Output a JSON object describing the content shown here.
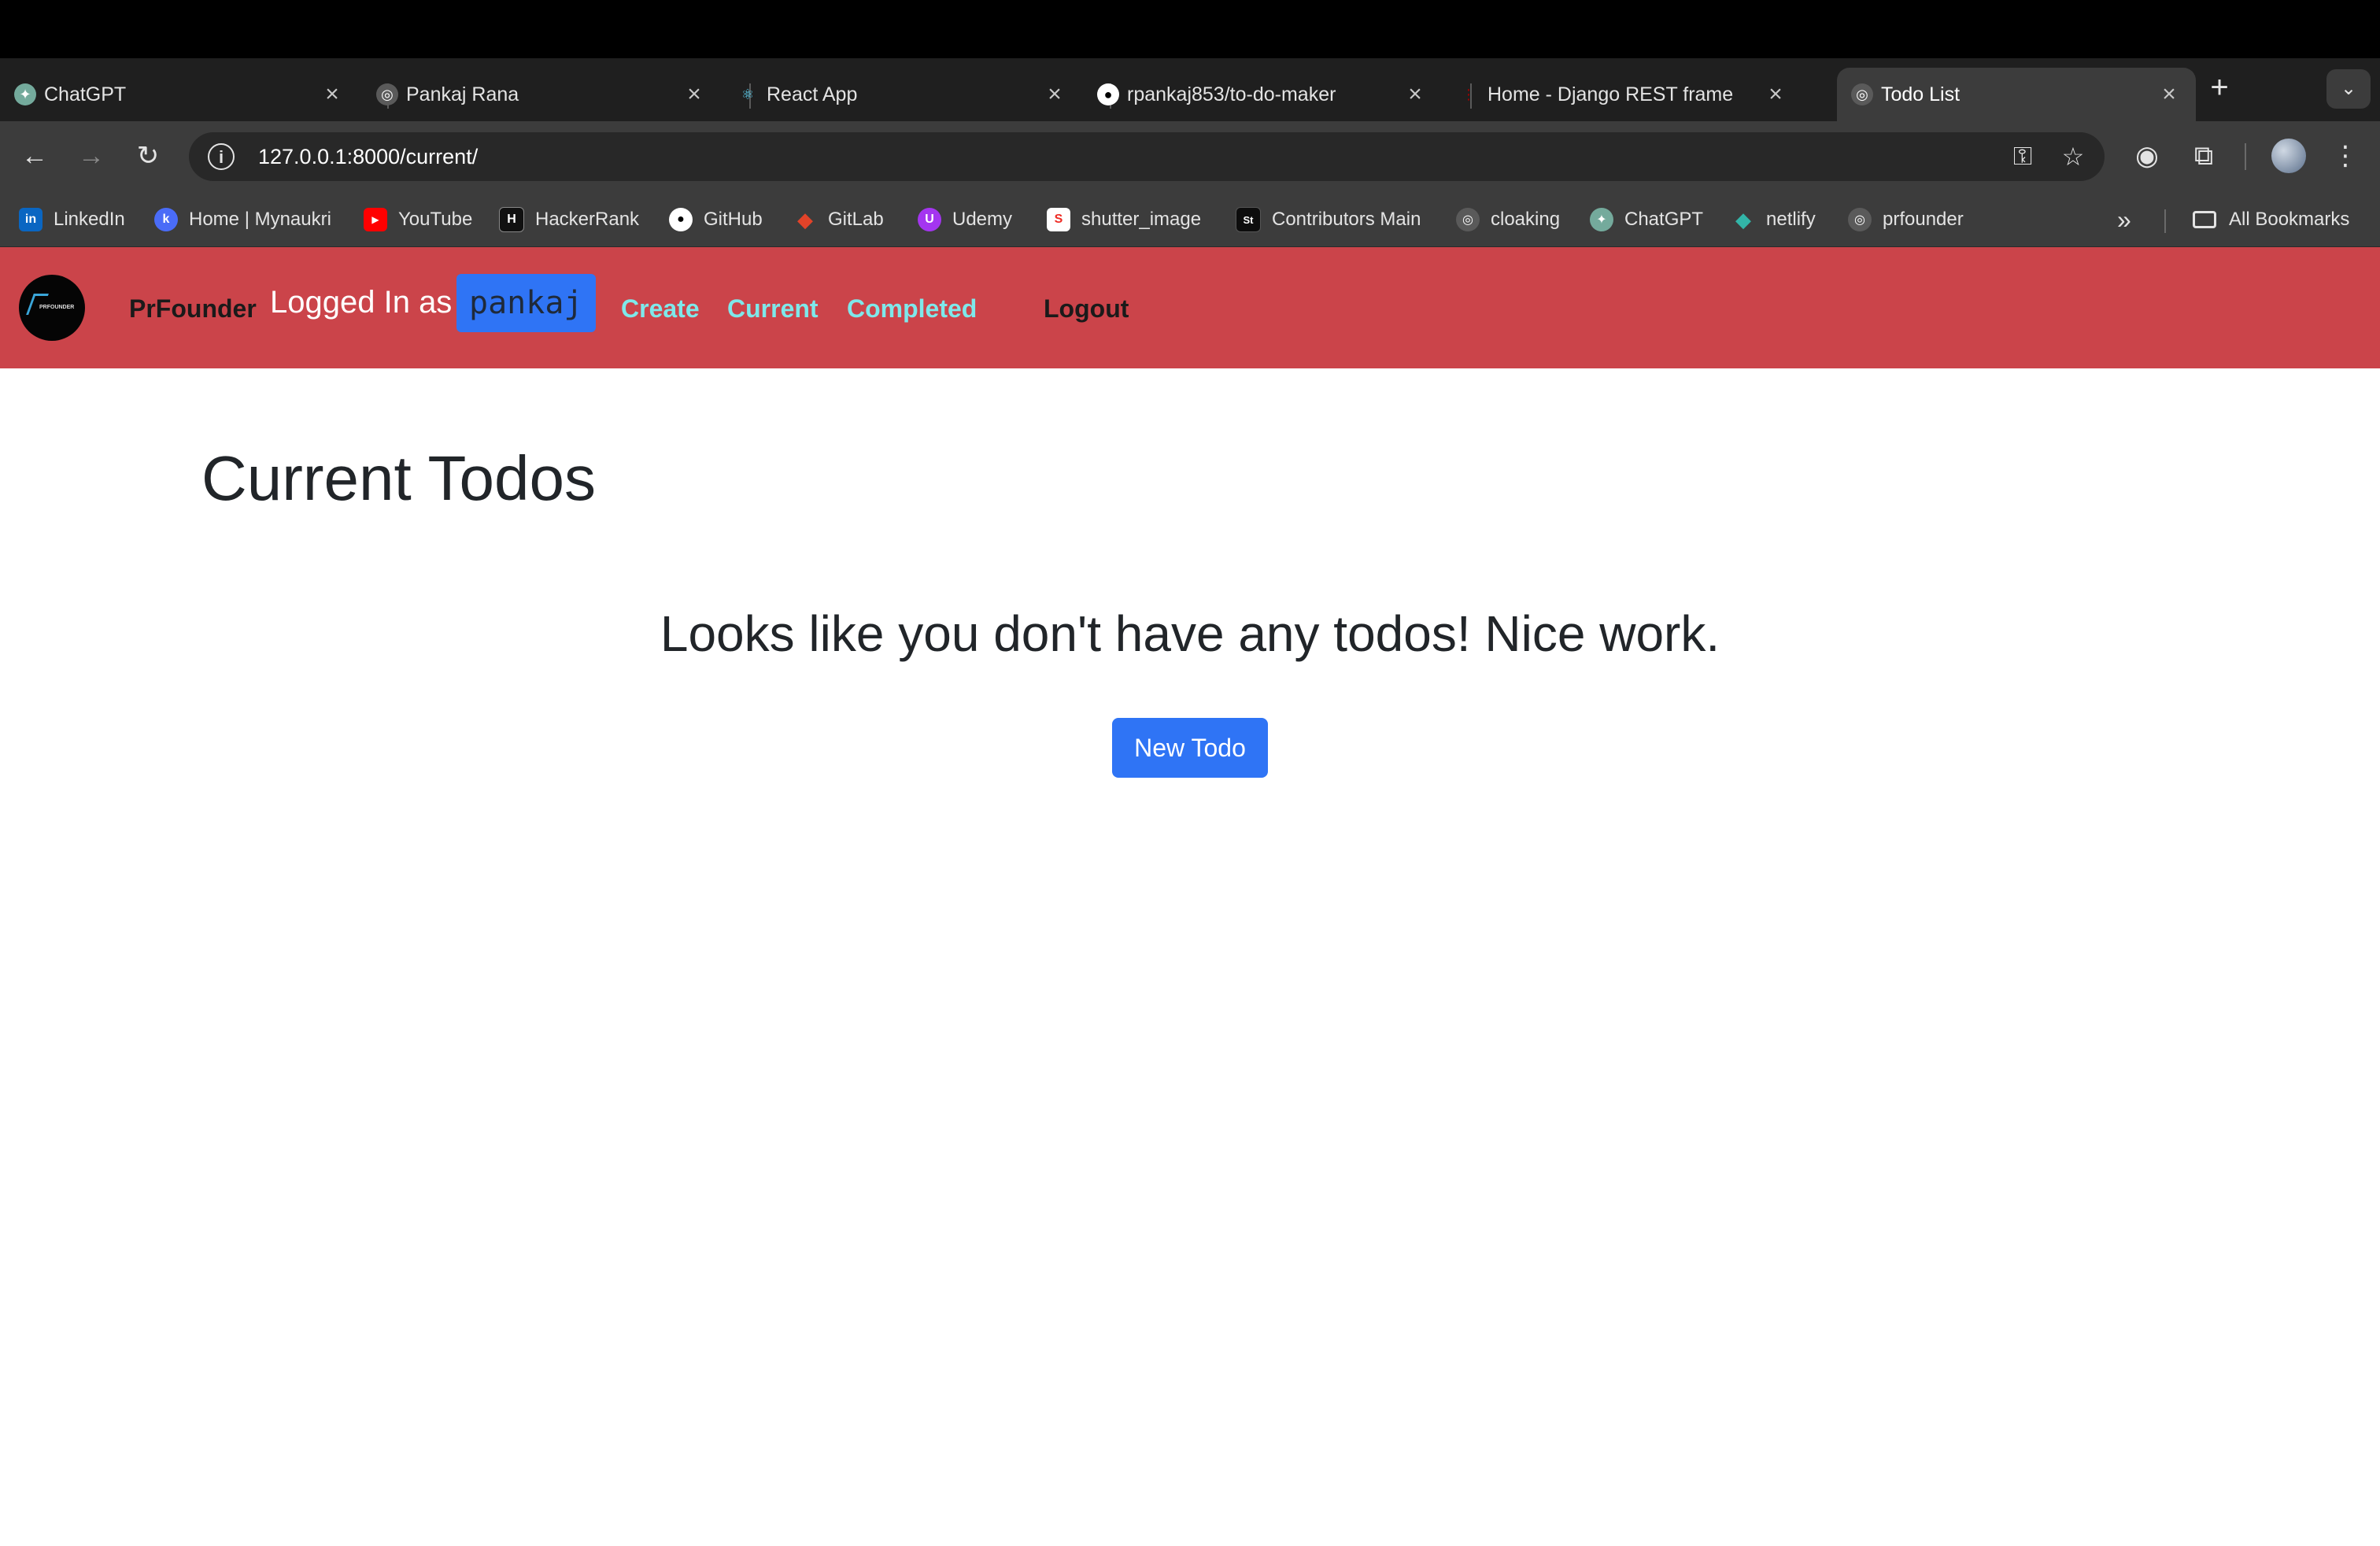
{
  "tabs": [
    {
      "title": "ChatGPT",
      "icon": "chatgpt-icon",
      "active": false
    },
    {
      "title": "Pankaj Rana",
      "icon": "globe-icon",
      "active": false
    },
    {
      "title": "React App",
      "icon": "react-icon",
      "active": false
    },
    {
      "title": "rpankaj853/to-do-maker",
      "icon": "github-icon",
      "active": false
    },
    {
      "title": "Home - Django REST frame",
      "icon": "django-icon",
      "active": false
    },
    {
      "title": "Todo List",
      "icon": "globe-icon",
      "active": true
    }
  ],
  "toolbar": {
    "url": "127.0.0.1:8000/current/"
  },
  "bookmarks": [
    {
      "label": "LinkedIn",
      "icon": "linkedin-icon",
      "color": "#0a66c2",
      "glyph": "in"
    },
    {
      "label": "Home | Mynaukri",
      "icon": "naukri-icon",
      "color": "#4a6cf7",
      "glyph": "k"
    },
    {
      "label": "YouTube",
      "icon": "youtube-icon",
      "color": "#ff0000",
      "glyph": "▶"
    },
    {
      "label": "HackerRank",
      "icon": "hackerrank-icon",
      "color": "#111111",
      "glyph": "H"
    },
    {
      "label": "GitHub",
      "icon": "github-icon",
      "color": "#3c3c3c",
      "glyph": "●"
    },
    {
      "label": "GitLab",
      "icon": "gitlab-icon",
      "color": "#e24329",
      "glyph": "◆"
    },
    {
      "label": "Udemy",
      "icon": "udemy-icon",
      "color": "#a435f0",
      "glyph": "U"
    },
    {
      "label": "shutter_image",
      "icon": "shutterstock-icon",
      "color": "#ee2b24",
      "glyph": "S"
    },
    {
      "label": "Contributors Main",
      "icon": "shutterstock-st-icon",
      "color": "#0d0d0d",
      "glyph": "St"
    },
    {
      "label": "cloaking",
      "icon": "globe-icon",
      "color": "#5a5a5a",
      "glyph": "◎"
    },
    {
      "label": "ChatGPT",
      "icon": "chatgpt-icon",
      "color": "#74aa9c",
      "glyph": "✦"
    },
    {
      "label": "netlify",
      "icon": "netlify-icon",
      "color": "#32b5a8",
      "glyph": "◆"
    },
    {
      "label": "prfounder",
      "icon": "globe-icon",
      "color": "#5a5a5a",
      "glyph": "◎"
    }
  ],
  "bookmarks_all": "All Bookmarks",
  "navbar": {
    "brand": "PrFounder",
    "logo_text": "PRFOUNDER",
    "logged_in_label": "Logged In as",
    "username": "pankaj",
    "links": [
      "Create",
      "Current",
      "Completed"
    ],
    "logout": "Logout",
    "bg_color": "#cb444a",
    "link_color": "#7ee8ea"
  },
  "main": {
    "heading": "Current Todos",
    "empty_message": "Looks like you don't have any todos! Nice work.",
    "new_todo_button": "New Todo",
    "button_color": "#2f74f5"
  }
}
